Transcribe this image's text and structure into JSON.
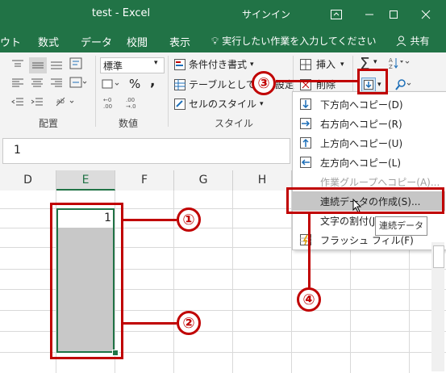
{
  "window": {
    "title": "test  -  Excel",
    "signin": "サインイン"
  },
  "tabs": [
    "ウト",
    "数式",
    "データ",
    "校閲",
    "表示"
  ],
  "tell_me": "実行したい作業を入力してください",
  "share": "共有",
  "ribbon": {
    "number_format": "標準",
    "percent": "%",
    "comma": ",",
    "conditional_format": "条件付き書式",
    "format_as_table": "テーブルとして書式設定",
    "cell_styles": "セルのスタイル",
    "insert": "挿入",
    "delete": "削除",
    "group_alignment": "配置",
    "group_number": "数値",
    "group_styles": "スタイル"
  },
  "formula_bar": {
    "value": "1"
  },
  "columns": [
    "D",
    "E",
    "F",
    "G",
    "H"
  ],
  "cell_value": "1",
  "fill_menu": {
    "items": [
      {
        "label": "下方向へコピー(D)",
        "icon": "arrow-down-icon",
        "enabled": true
      },
      {
        "label": "右方向へコピー(R)",
        "icon": "arrow-right-icon",
        "enabled": true
      },
      {
        "label": "上方向へコピー(U)",
        "icon": "arrow-up-icon",
        "enabled": true
      },
      {
        "label": "左方向へコピー(L)",
        "icon": "arrow-left-icon",
        "enabled": true
      },
      {
        "label": "作業グループへコピー(A)...",
        "icon": "",
        "enabled": false
      },
      {
        "label": "連続データの作成(S)...",
        "icon": "",
        "enabled": true,
        "highlighted": true
      },
      {
        "label": "文字の割付(J)",
        "icon": "",
        "enabled": true
      },
      {
        "label": "フラッシュ フィル(F)",
        "icon": "flash-fill-icon",
        "enabled": true
      }
    ]
  },
  "tooltip": "連続データ",
  "callouts": [
    "①",
    "②",
    "③",
    "④"
  ],
  "colors": {
    "excel_green": "#217346",
    "callout_red": "#c00000"
  }
}
